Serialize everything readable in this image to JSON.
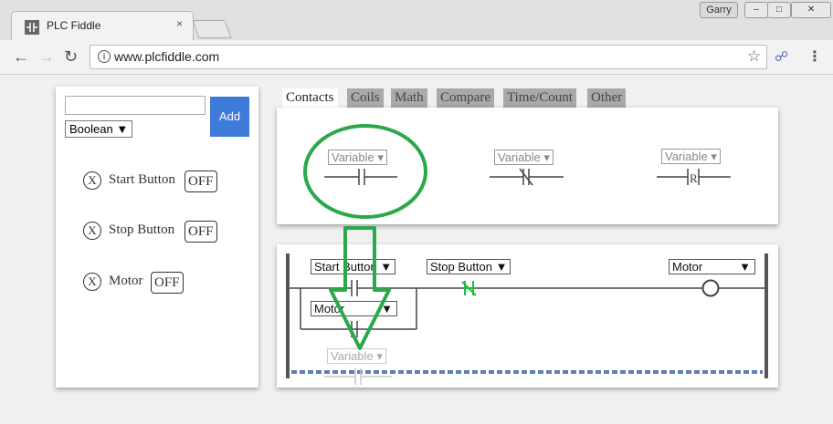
{
  "browser": {
    "tab_title": "PLC Fiddle",
    "tab_close": "×",
    "url": "www.plcfiddle.com",
    "user_name": "Garry",
    "window_buttons": {
      "minimize": "–",
      "maximize": "□",
      "close": "✕"
    }
  },
  "variables_panel": {
    "name_input_value": "",
    "type_selected": "Boolean",
    "add_label": "Add",
    "items": [
      {
        "name": "Start Button",
        "state": "OFF"
      },
      {
        "name": "Stop Button",
        "state": "OFF"
      },
      {
        "name": "Motor",
        "state": "OFF"
      }
    ],
    "delete_glyph": "X"
  },
  "palette": {
    "tabs": [
      "Contacts",
      "Coils",
      "Math",
      "Compare",
      "Time/Count",
      "Other"
    ],
    "active_tab": "Contacts",
    "contacts": [
      {
        "select": "Variable",
        "type": "normally-open"
      },
      {
        "select": "Variable",
        "type": "normally-closed"
      },
      {
        "select": "Variable",
        "type": "rising-edge",
        "symbol": "R"
      }
    ]
  },
  "ladder": {
    "rung1": {
      "contact1": "Start Button",
      "branch_contact": "Motor",
      "contact2": "Stop Button",
      "coil": "Motor"
    },
    "dragging_element": "Variable"
  },
  "colors": {
    "annotation_green": "#2aa84a",
    "active_contact_green": "#1fbf3a",
    "add_button": "#3e7ad8",
    "dashed_rung": "#5b7fb0"
  }
}
